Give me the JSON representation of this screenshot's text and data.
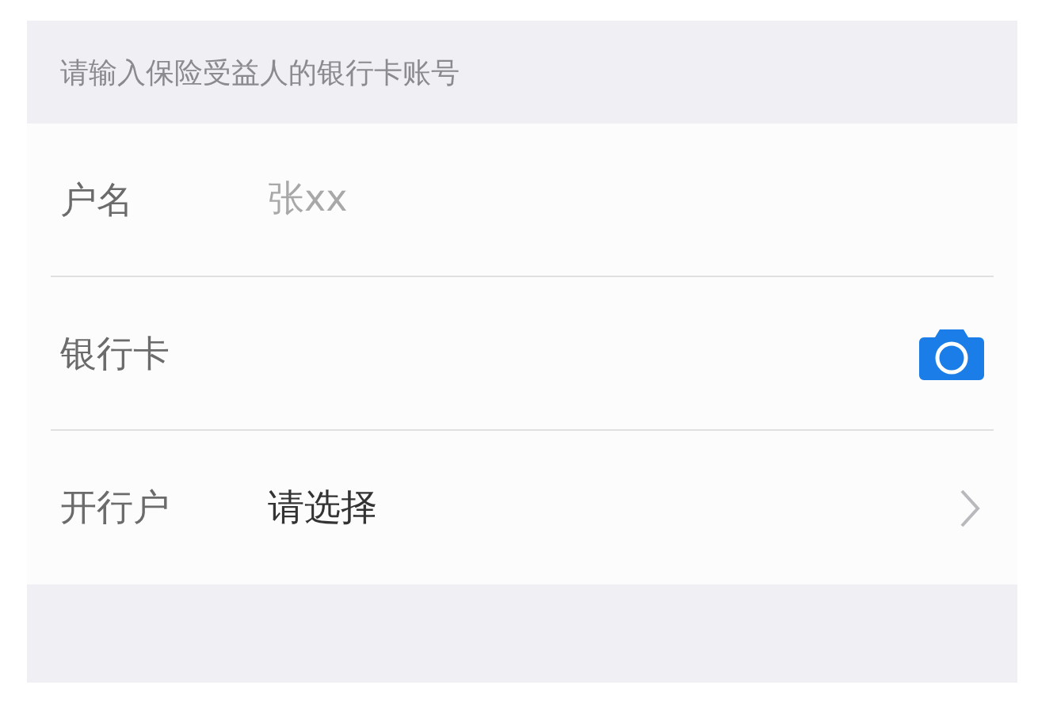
{
  "header": {
    "text": "请输入保险受益人的银行卡账号"
  },
  "rows": [
    {
      "kind": "input",
      "label": "户名",
      "placeholder": "张xx"
    },
    {
      "kind": "camera",
      "label": "银行卡"
    },
    {
      "kind": "select",
      "label": "开行户",
      "value": "请选择"
    }
  ]
}
